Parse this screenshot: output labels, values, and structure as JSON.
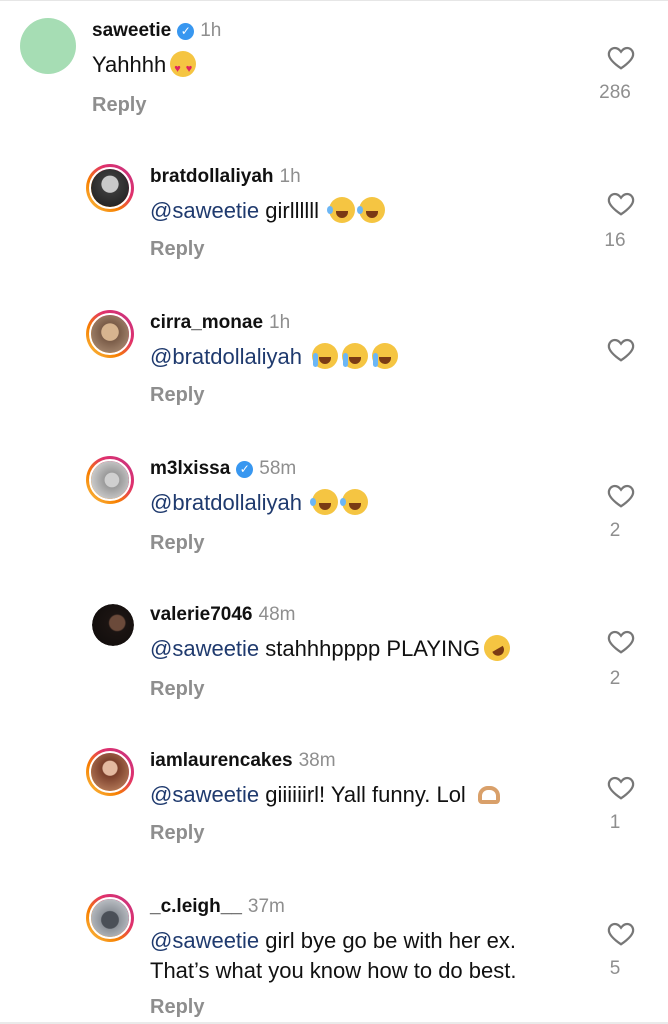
{
  "comments": [
    {
      "user": "saweetie",
      "verified": true,
      "time": "1h",
      "mention": "",
      "text": "Yahhhh",
      "emojis": [
        "heart-eyes"
      ],
      "reply": "Reply",
      "likes": "286"
    },
    {
      "user": "bratdollaliyah",
      "verified": false,
      "time": "1h",
      "mention": "@saweetie",
      "text": " girllllll",
      "emojis": [
        "laugh",
        "laugh"
      ],
      "reply": "Reply",
      "likes": "16"
    },
    {
      "user": "cirra_monae",
      "verified": false,
      "time": "1h",
      "mention": "@bratdollaliyah",
      "text": "",
      "emojis": [
        "cry",
        "cry",
        "cry"
      ],
      "reply": "Reply",
      "likes": ""
    },
    {
      "user": "m3lxissa",
      "verified": true,
      "time": "58m",
      "mention": "@bratdollaliyah",
      "text": "",
      "emojis": [
        "laugh",
        "laugh"
      ],
      "reply": "Reply",
      "likes": "2"
    },
    {
      "user": "valerie7046",
      "verified": false,
      "time": "48m",
      "mention": "@saweetie",
      "text": " stahhhpppp PLAYING",
      "emojis": [
        "rofl"
      ],
      "reply": "Reply",
      "likes": "2"
    },
    {
      "user": "iamlaurencakes",
      "verified": false,
      "time": "38m",
      "mention": "@saweetie",
      "text": " giiiiiirl! Yall funny. Lol ",
      "emojis": [
        "hands"
      ],
      "reply": "Reply",
      "likes": "1"
    },
    {
      "user": "_c.leigh__",
      "verified": false,
      "time": "37m",
      "mention": "@saweetie",
      "text": " girl bye go be with her ex.",
      "text_line2": "That’s what you know how to do best.",
      "emojis": [],
      "reply": "Reply",
      "likes": "5"
    }
  ],
  "icons": {
    "like": "heart-outline-icon",
    "verified": "verified-badge-icon"
  },
  "colors": {
    "mention": "#1f3a6e",
    "muted": "#8e8e8e",
    "verified": "#3897f0",
    "placeholder_avatar": "#a6ddb4"
  }
}
